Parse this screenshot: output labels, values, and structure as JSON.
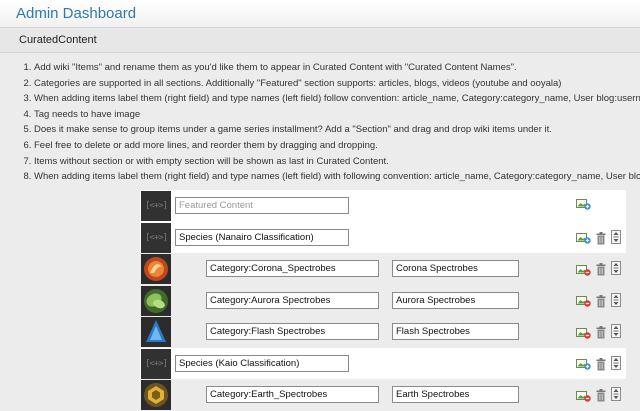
{
  "header": {
    "title": "Admin Dashboard"
  },
  "section": {
    "title": "CuratedContent"
  },
  "instructions": [
    "Add wiki \"Items\" and rename them as you'd like them to appear in Curated Content with \"Curated Content Names\".",
    "Categories are supported in all sections. Additionally \"Featured\" section supports: articles, blogs, videos (youtube and ooyala)",
    "When adding items label them (right field) and type names (left field) follow convention: article_name, Category:category_name, User blog:username/post_name",
    "Tag needs to have image",
    "Does it make sense to group items under a game series installment? Add a \"Section\" and drag and drop wiki items under it.",
    "Feel free to delete or add more lines, and reorder them by dragging and dropping.",
    "Items without section or with empty section will be shown as last in Curated Content.",
    "When adding items label them (right field) and type names (left field) with following convention: article_name, Category:category_name, User blog:username/post_name"
  ],
  "rows": [
    {
      "kind": "section",
      "label": "",
      "placeholder": "Featured Content",
      "thumb": "placeholder"
    },
    {
      "kind": "section",
      "label": "Species (Nanairo Classification)",
      "thumb": "placeholder"
    },
    {
      "kind": "item",
      "label": "Category:Corona_Spectrobes",
      "name": "Corona Spectrobes",
      "thumb": "corona"
    },
    {
      "kind": "item",
      "label": "Category:Aurora Spectrobes",
      "name": "Aurora Spectrobes",
      "thumb": "aurora"
    },
    {
      "kind": "item",
      "label": "Category:Flash Spectrobes",
      "name": "Flash Spectrobes",
      "thumb": "flash"
    },
    {
      "kind": "section",
      "label": "Species (Kaio Classification)",
      "thumb": "placeholder"
    },
    {
      "kind": "item",
      "label": "Category:Earth_Spectrobes",
      "name": "Earth Spectrobes",
      "thumb": "earth"
    }
  ],
  "icons": {
    "add_image": "image-add-icon",
    "remove_image": "image-remove-icon",
    "delete": "trash-icon",
    "move": "drag-handle-icon"
  },
  "colors": {
    "title": "#2e79b4",
    "add": "#2f8fd6",
    "remove": "#d93a2b"
  }
}
